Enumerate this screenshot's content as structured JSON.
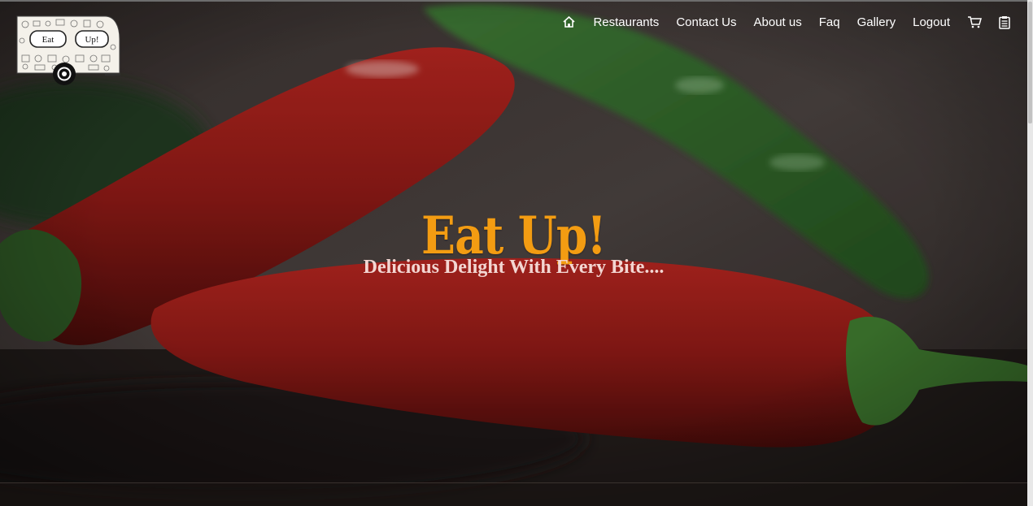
{
  "logo": {
    "line1": "Eat",
    "line2": "Up!"
  },
  "nav": {
    "home_icon": "home-icon",
    "items": [
      {
        "label": "Restaurants"
      },
      {
        "label": "Contact Us"
      },
      {
        "label": "About us"
      },
      {
        "label": "Faq"
      },
      {
        "label": "Gallery"
      },
      {
        "label": "Logout"
      }
    ],
    "cart_icon": "cart-icon",
    "orders_icon": "clipboard-icon"
  },
  "hero": {
    "title": "Eat Up!",
    "subtitle": "Delicious Delight With Every Bite....",
    "colors": {
      "title": "#f39c12",
      "subtitle": "#f3d6d2"
    }
  }
}
